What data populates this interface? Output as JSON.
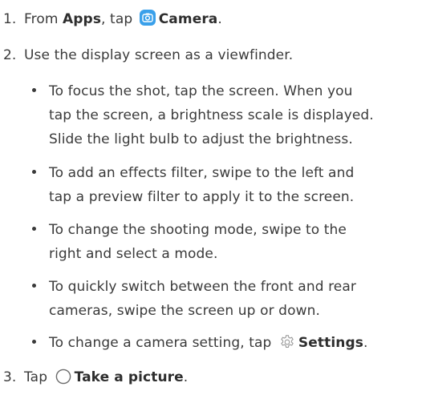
{
  "steps": [
    {
      "num": "1.",
      "pre": "From ",
      "apps": "Apps",
      "mid": ", tap ",
      "camera": "Camera",
      "post": "."
    },
    {
      "num": "2.",
      "text": "Use the display screen as a viewfinder."
    },
    {
      "num": "3.",
      "pre": "Tap ",
      "action": "Take a picture",
      "post": "."
    }
  ],
  "bullets": [
    {
      "lines": [
        "To focus the shot, tap the screen. When you",
        "tap the screen, a brightness scale is displayed.",
        "Slide the light bulb to adjust the brightness."
      ]
    },
    {
      "lines": [
        "To add an effects filter, swipe to the left and",
        "tap a preview filter to apply it to the screen."
      ]
    },
    {
      "lines": [
        "To change the shooting mode, swipe to the",
        "right and select a mode."
      ]
    },
    {
      "lines": [
        "To quickly switch between the front and rear",
        "cameras, swipe the screen up or down."
      ]
    },
    {
      "pre": "To change a camera setting, tap ",
      "settings": "Settings",
      "post": "."
    }
  ],
  "icons": {
    "camera": "camera-app-icon",
    "settings": "gear-icon",
    "shutter": "circle-icon"
  },
  "colors": {
    "camera_icon": "#3aa0ea",
    "text": "#3a3a3a"
  }
}
